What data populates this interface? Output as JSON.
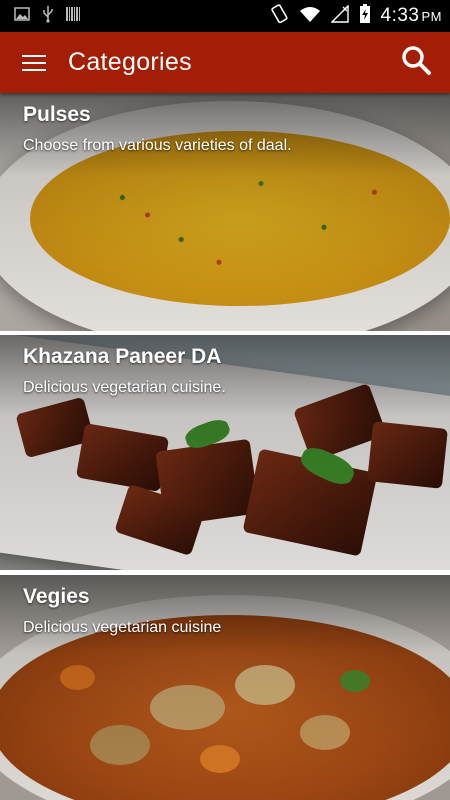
{
  "status_bar": {
    "time": "4:33",
    "ampm": "PM",
    "icons": [
      "image-icon",
      "usb-icon",
      "barcode-icon",
      "rotate-icon",
      "wifi-icon",
      "signal-icon",
      "battery-charging-icon"
    ]
  },
  "toolbar": {
    "title": "Categories",
    "background": "#a31e05",
    "menu_icon": "hamburger-icon",
    "search_icon": "search-icon"
  },
  "categories": [
    {
      "title": "Pulses",
      "description": "Choose from various varieties of daal."
    },
    {
      "title": "Khazana Paneer DA",
      "description": "Delicious vegetarian cuisine."
    },
    {
      "title": "Vegies",
      "description": "Delicious vegetarian cuisine"
    }
  ]
}
